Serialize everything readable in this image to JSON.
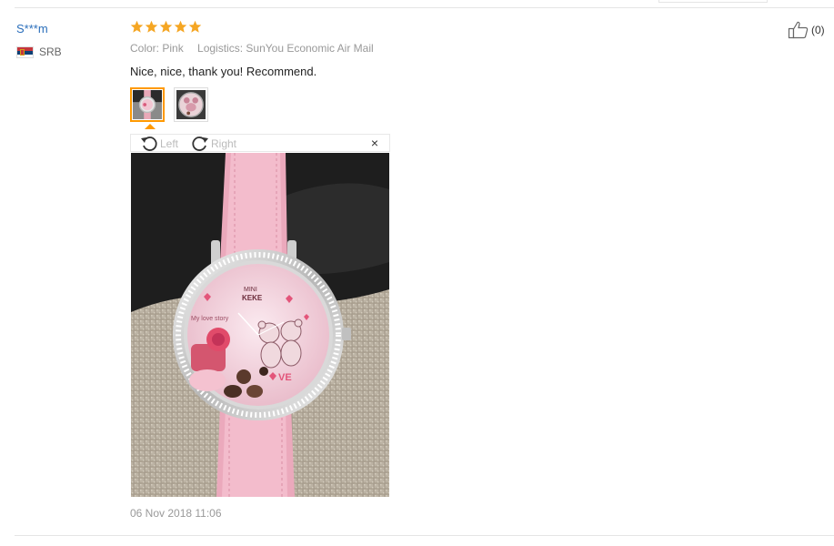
{
  "review": {
    "user": "S***m",
    "country_code": "SRB",
    "rating": 5,
    "color_label": "Color: Pink",
    "logistics_label": "Logistics: SunYou Economic Air Mail",
    "comment": "Nice, nice, thank you! Recommend.",
    "date": "06 Nov 2018 11:06",
    "helpful_count": "(0)"
  },
  "viewer": {
    "rotate_left": "Left",
    "rotate_right": "Right",
    "close": "×"
  },
  "colors": {
    "star": "#f5a623",
    "link": "#2a6ebb",
    "accent": "#ff9900",
    "meta_text": "#999999"
  },
  "icons": [
    "star-icon",
    "thumbs-up-icon",
    "rotate-left-icon",
    "rotate-right-icon",
    "close-icon",
    "serbia-flag-icon"
  ]
}
